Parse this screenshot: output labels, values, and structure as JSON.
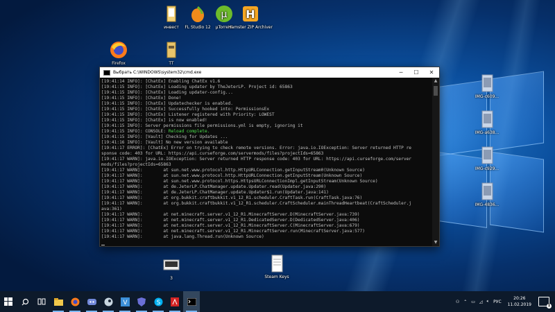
{
  "desktop": {
    "icons": [
      {
        "label": "инвест",
        "icon": "folder-document-icon"
      },
      {
        "label": "FL Studio 12",
        "icon": "fl-studio-icon"
      },
      {
        "label": "µTorrent",
        "icon": "utorrent-icon"
      },
      {
        "label": "Hamster ZIP Archiver",
        "icon": "hamster-zip-icon"
      },
      {
        "label": "Firefox",
        "icon": "firefox-icon"
      },
      {
        "label": "TT",
        "icon": "folder-icon"
      },
      {
        "label": "IMG-c609...",
        "icon": "image-file-icon"
      },
      {
        "label": "IMG-a638...",
        "icon": "image-file-icon"
      },
      {
        "label": "IMG-c929...",
        "icon": "image-file-icon"
      },
      {
        "label": "IMG-4836...",
        "icon": "image-file-icon"
      },
      {
        "label": "3",
        "icon": "screenshot-file-icon"
      },
      {
        "label": "Steam Keys",
        "icon": "text-document-icon"
      }
    ]
  },
  "cmd_window": {
    "title": "Выбрать C:\\WINDOWS\\system32\\cmd.exe",
    "minimize": "─",
    "maximize": "☐",
    "close": "✕",
    "lines": [
      "[19:41:14 INFO]: [ChatEx] Enabling ChatEx v1.6",
      "[19:41:15 INFO]: [ChatEx] Loading updater by TheJeterLP. Project id: 65863",
      "[19:41:15 INFO]: [ChatEx] Loading updater-config...",
      "[19:41:15 INFO]: [ChatEx] Done!",
      "[19:41:15 INFO]: [ChatEx] Updatechecker is enabled.",
      "[19:41:15 INFO]: [ChatEx] Successfully hooked into: PermissionsEx",
      "[19:41:15 INFO]: [ChatEx] Listener registered with Priority: LOWEST",
      "[19:41:15 INFO]: [ChatEx] is now enabled!",
      "[19:41:15 INFO]: Server permissions file permissions.yml is empty, ignoring it",
      "[19:41:15 INFO]: CONSOLE: ",
      "[19:41:15 INFO]: [Vault] Checking for Updates ...",
      "[19:41:16 INFO]: [Vault] No new version available",
      "[19:41:17 ERROR]: [ChatEx] Error on trying to check remote versions. Error: java.io.IOException: Server returned HTTP re",
      "sponse code: 403 for URL: https://api.curseforge.com/servermods/files?projectIds=65863",
      "[19:41:17 WARN]: java.io.IOException: Server returned HTTP response code: 403 for URL: https://api.curseforge.com/server",
      "mods/files?projectIds=65863",
      "[19:41:17 WARN]:        at sun.net.www.protocol.http.HttpURLConnection.getInputStream0(Unknown Source)",
      "[19:41:17 WARN]:        at sun.net.www.protocol.http.HttpURLConnection.getInputStream(Unknown Source)",
      "[19:41:17 WARN]:        at sun.net.www.protocol.https.HttpsURLConnectionImpl.getInputStream(Unknown Source)",
      "[19:41:17 WARN]:        at de.JeterLP.ChatManager.update.Updater.read(Updater.java:290)",
      "[19:41:17 WARN]:        at de.JeterLP.ChatManager.update.Updater$1.run(Updater.java:141)",
      "[19:41:17 WARN]:        at org.bukkit.craftbukkit.v1_12_R1.scheduler.CraftTask.run(CraftTask.java:76)",
      "[19:41:17 WARN]:        at org.bukkit.craftbukkit.v1_12_R1.scheduler.CraftScheduler.mainThreadHeartbeat(CraftScheduler.j",
      "ava:361)",
      "[19:41:17 WARN]:        at net.minecraft.server.v1_12_R1.MinecraftServer.D(MinecraftServer.java:739)",
      "[19:41:17 WARN]:        at net.minecraft.server.v1_12_R1.DedicatedServer.D(DedicatedServer.java:406)",
      "[19:41:17 WARN]:        at net.minecraft.server.v1_12_R1.MinecraftServer.C(MinecraftServer.java:679)",
      "[19:41:17 WARN]:        at net.minecraft.server.v1_12_R1.MinecraftServer.run(MinecraftServer.java:577)",
      "[19:41:17 WARN]:        at java.lang.Thread.run(Unknown Source)"
    ],
    "reload_text": "Reload complete."
  },
  "taskbar": {
    "items": [
      {
        "icon": "windows-start-icon"
      },
      {
        "icon": "search-icon"
      },
      {
        "icon": "task-view-icon"
      },
      {
        "icon": "file-explorer-icon"
      },
      {
        "icon": "firefox-icon"
      },
      {
        "icon": "discord-icon"
      },
      {
        "icon": "steam-icon"
      },
      {
        "icon": "vimeworld-icon"
      },
      {
        "icon": "app-shield-icon"
      },
      {
        "icon": "skype-icon"
      },
      {
        "icon": "pdf-reader-icon"
      },
      {
        "icon": "cmd-icon"
      }
    ],
    "language": "РУС",
    "time": "20:26",
    "date": "11.02.2019",
    "notifications": "1"
  },
  "colors": {
    "console_ok": "#4fe04f",
    "taskbar": "#0d1a2b"
  }
}
